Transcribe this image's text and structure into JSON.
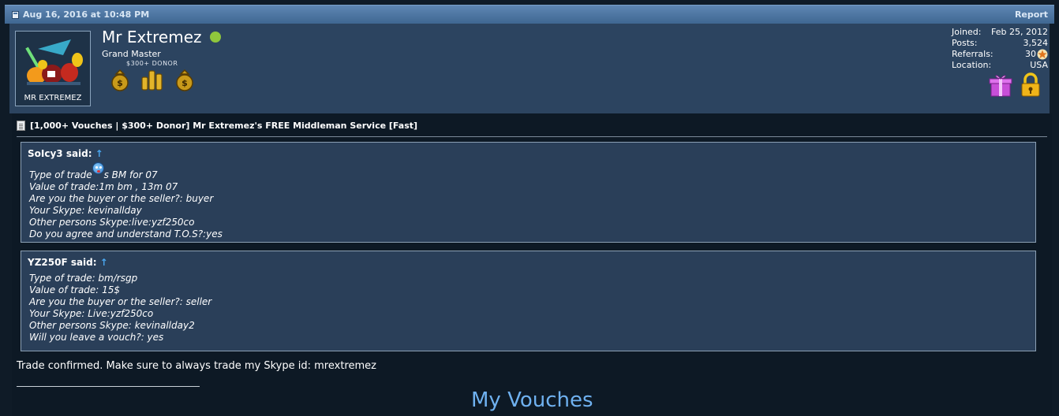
{
  "post": {
    "date": "Aug 16, 2016 at 10:48 PM",
    "report_label": "Report"
  },
  "user": {
    "name": "Mr Extremez",
    "title": "Grand Master",
    "donor_label": "$300+ DONOR",
    "avatar_caption": "MR EXTREMEZ",
    "online_color": "#8fc63c",
    "badges": [
      "gold-sack-icon",
      "gold-coins-icon",
      "gold-sack-icon"
    ],
    "stats": {
      "joined_label": "Joined:",
      "joined_value": "Feb 25, 2012",
      "posts_label": "Posts:",
      "posts_value": "3,524",
      "referrals_label": "Referrals:",
      "referrals_value": "30",
      "location_label": "Location:",
      "location_value": "USA"
    },
    "icons": [
      "gift-icon",
      "lock-icon"
    ]
  },
  "thread": {
    "title": "[1,000+ Vouches | $300+ Donor] Mr Extremez's FREE Middleman Service [Fast]"
  },
  "quotes": [
    {
      "author": "SoIcy3 said:",
      "arrow": "↑",
      "lines": [
        "Type of trade",
        "s BM for 07",
        "Value of trade:1m bm , 13m 07",
        "Are you the buyer or the seller?: buyer",
        "Your Skype: kevinallday",
        "Other persons Skype:live:yzf250co",
        "Do you agree and understand T.O.S?:yes"
      ]
    },
    {
      "author": "YZ250F said:",
      "arrow": "↑",
      "lines": [
        "Type of trade: bm/rsgp",
        "Value of trade: 15$",
        "Are you the buyer or the seller?: seller",
        "Your Skype: Live:yzf250co",
        "Other persons Skype: kevinallday2",
        "Will you leave a vouch?: yes"
      ]
    }
  ],
  "confirm_text": "Trade confirmed. Make sure to always trade my Skype id: mrextremez",
  "signature_heading": "My Vouches",
  "colors": {
    "header_bar": "#4f78a4",
    "user_bar": "#2c4460",
    "quote_bg": "#2a3f59",
    "accent_link": "#6fb1f0"
  }
}
